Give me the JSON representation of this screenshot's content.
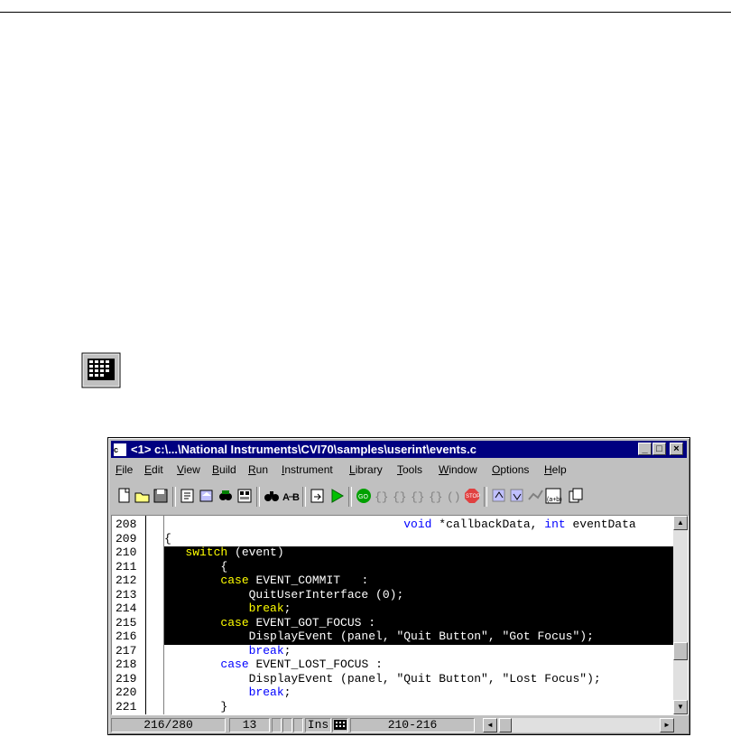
{
  "window": {
    "title": "<1> c:\\...\\National Instruments\\CVI70\\samples\\userint\\events.c",
    "title_icon": "c",
    "controls": [
      "_",
      "□",
      "×"
    ]
  },
  "menu": [
    "File",
    "Edit",
    "View",
    "Build",
    "Run",
    "Instrument",
    "Library",
    "Tools",
    "Window",
    "Options",
    "Help"
  ],
  "editor": {
    "line_numbers": [
      "208",
      "209",
      "210",
      "211",
      "212",
      "213",
      "214",
      "215",
      "216",
      "217",
      "218",
      "219",
      "220",
      "221"
    ],
    "lines": [
      {
        "pre": "                                  ",
        "kw1": "void",
        "mid": " *callbackData, ",
        "kw2": "int",
        "post": " eventData"
      },
      {
        "pre": "{",
        "kw1": "",
        "mid": "",
        "kw2": "",
        "post": ""
      },
      {
        "pre": "   ",
        "kw1": "switch",
        "mid": " (event)",
        "kw2": "",
        "post": ""
      },
      {
        "pre": "        {",
        "kw1": "",
        "mid": "",
        "kw2": "",
        "post": ""
      },
      {
        "pre": "        ",
        "kw1": "case",
        "mid": " EVENT_COMMIT   :",
        "kw2": "",
        "post": ""
      },
      {
        "pre": "            QuitUserInterface (0);",
        "kw1": "",
        "mid": "",
        "kw2": "",
        "post": ""
      },
      {
        "pre": "            ",
        "kw1": "break",
        "mid": ";",
        "kw2": "",
        "post": ""
      },
      {
        "pre": "        ",
        "kw1": "case",
        "mid": " EVENT_GOT_FOCUS :",
        "kw2": "",
        "post": ""
      },
      {
        "pre": "            DisplayEvent (panel, \"Quit Button\", \"Got Focus\");",
        "kw1": "",
        "mid": "",
        "kw2": "",
        "post": ""
      },
      {
        "pre": "            ",
        "kw1": "break",
        "mid": ";",
        "kw2": "",
        "post": ""
      },
      {
        "pre": "        ",
        "kw1": "case",
        "mid": " EVENT_LOST_FOCUS :",
        "kw2": "",
        "post": ""
      },
      {
        "pre": "            DisplayEvent (panel, \"Quit Button\", \"Lost Focus\");",
        "kw1": "",
        "mid": "",
        "kw2": "",
        "post": ""
      },
      {
        "pre": "            ",
        "kw1": "break",
        "mid": ";",
        "kw2": "",
        "post": ""
      },
      {
        "pre": "        }",
        "kw1": "",
        "mid": "",
        "kw2": "",
        "post": ""
      }
    ],
    "selected_lines": [
      210,
      216
    ]
  },
  "status": {
    "position": "216/280",
    "column": "13",
    "mode": "Ins",
    "selection": "210-216"
  },
  "colors": {
    "titlebar": "#000080",
    "keyword": "#0000ff",
    "selected_keyword": "#ffff00",
    "selection": "#000000"
  }
}
